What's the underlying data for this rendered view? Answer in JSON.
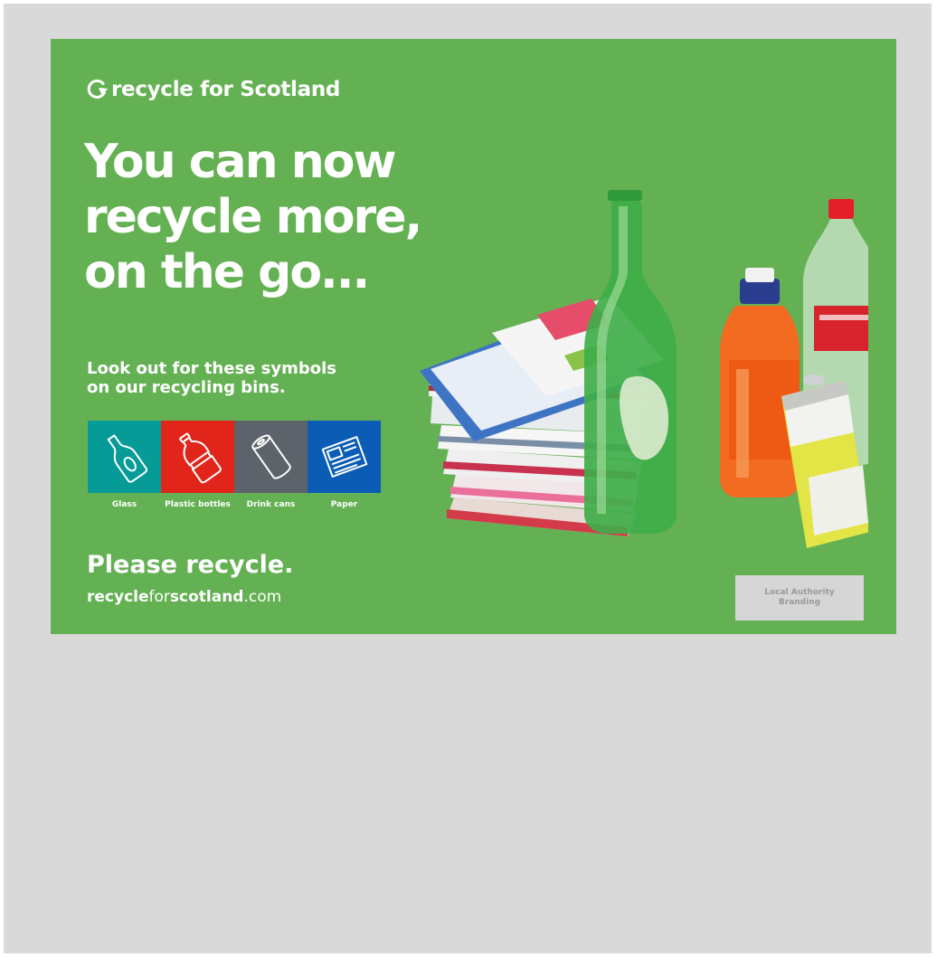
{
  "logo": {
    "text": "recycle for Scotland"
  },
  "headline": {
    "lines": [
      "You can now",
      "recycle more,",
      "on the go..."
    ]
  },
  "subheading": {
    "lines": [
      "Look out for these symbols",
      "on our recycling bins."
    ]
  },
  "symbols": [
    {
      "label": "Glass",
      "icon": "glass-bottle-icon",
      "color": "#069b97"
    },
    {
      "label": "Plastic bottles",
      "icon": "plastic-bottle-icon",
      "color": "#e1251b"
    },
    {
      "label": "Drink cans",
      "icon": "drink-can-icon",
      "color": "#5c636a"
    },
    {
      "label": "Paper",
      "icon": "newspaper-icon",
      "color": "#0a5cb5"
    }
  ],
  "cta": {
    "text": "Please recycle."
  },
  "website": {
    "part1": "recycle",
    "part2": "for",
    "part3": "scotland",
    "part4": ".com"
  },
  "local_authority": {
    "lines": [
      "Local Authority",
      "Branding"
    ]
  },
  "colors": {
    "poster_green": "#64b153",
    "page_grey": "#d9d9d9",
    "placeholder_grey": "#d6d6d6"
  }
}
